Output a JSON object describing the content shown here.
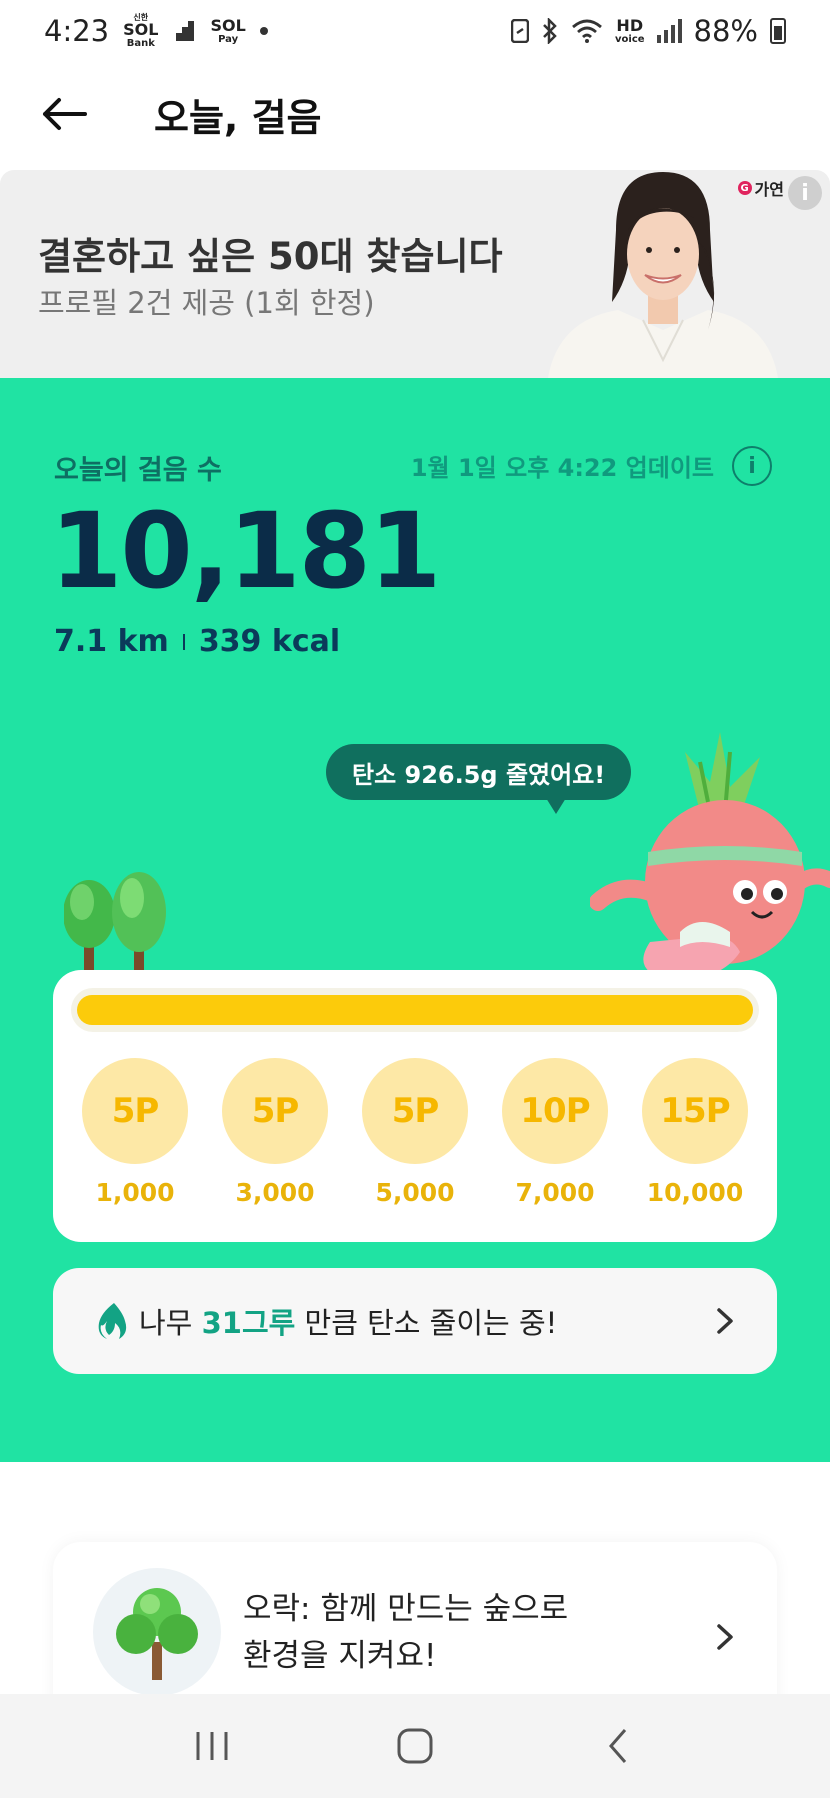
{
  "status_bar": {
    "time": "4:23",
    "app1_top": "신한",
    "app1_main": "SOL",
    "app1_sub": "Bank",
    "app2_main": "SOL",
    "app2_sub": "Pay",
    "hd_label": "HD",
    "hd_sub": "voice",
    "battery": "88%"
  },
  "header": {
    "title": "오늘, 걸음"
  },
  "ad": {
    "title": "결혼하고 싶은 50대 찾습니다",
    "subtitle": "프로필 2건 제공 (1회 한정)",
    "brand": "가연",
    "brand_mark": "G",
    "info_icon": "i"
  },
  "steps": {
    "label": "오늘의 걸음 수",
    "updated": "1월 1일 오후 4:22 업데이트",
    "info_icon": "i",
    "count": "10,181",
    "distance": "7.1 km",
    "calories": "339 kcal"
  },
  "carbon_bubble": "탄소 926.5g 줄였어요!",
  "progress": {
    "fraction": 1.0,
    "milestones": [
      {
        "points": "5P",
        "steps": "1,000"
      },
      {
        "points": "5P",
        "steps": "3,000"
      },
      {
        "points": "5P",
        "steps": "5,000"
      },
      {
        "points": "10P",
        "steps": "7,000"
      },
      {
        "points": "15P",
        "steps": "10,000"
      }
    ]
  },
  "tree_card": {
    "prefix": "나무 ",
    "highlight": "31그루",
    "suffix": " 만큼 탄소 줄이는 중!"
  },
  "orak_card": {
    "line1": "오락: 함께 만드는 숲으로",
    "line2": "환경을 지켜요!"
  },
  "colors": {
    "accent_green": "#20e3a3",
    "dark_navy": "#0b2c48",
    "progress_yellow": "#fccb0b",
    "highlight_teal": "#13a384"
  }
}
